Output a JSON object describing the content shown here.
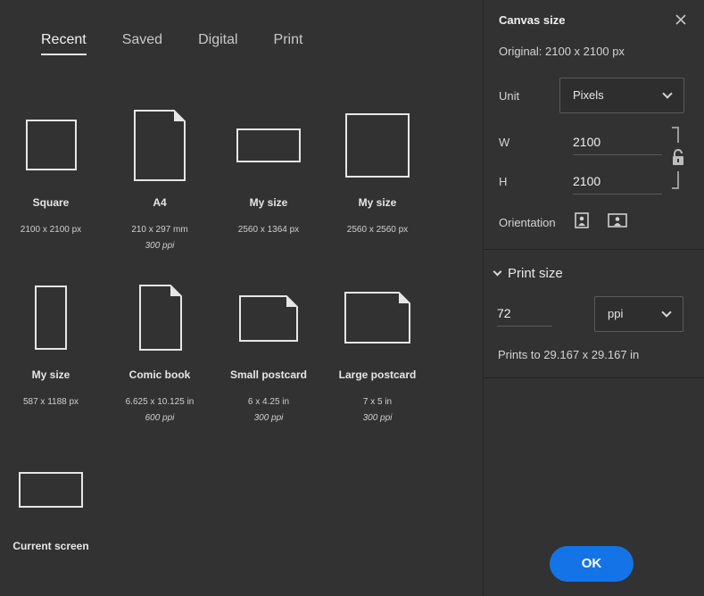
{
  "tabs": [
    {
      "label": "Recent"
    },
    {
      "label": "Saved"
    },
    {
      "label": "Digital"
    },
    {
      "label": "Print"
    }
  ],
  "presets": [
    {
      "name": "Square",
      "dims": "2100 x 2100 px",
      "ppi": ""
    },
    {
      "name": "A4",
      "dims": "210 x 297 mm",
      "ppi": "300 ppi"
    },
    {
      "name": "My size",
      "dims": "2560 x 1364 px",
      "ppi": ""
    },
    {
      "name": "My size",
      "dims": "2560 x 2560 px",
      "ppi": ""
    },
    {
      "name": "My size",
      "dims": "587 x 1188 px",
      "ppi": ""
    },
    {
      "name": "Comic book",
      "dims": "6.625 x 10.125 in",
      "ppi": "600 ppi"
    },
    {
      "name": "Small postcard",
      "dims": "6 x 4.25 in",
      "ppi": "300 ppi"
    },
    {
      "name": "Large postcard",
      "dims": "7 x 5 in",
      "ppi": "300 ppi"
    },
    {
      "name": "Current screen",
      "dims": "",
      "ppi": ""
    }
  ],
  "panel": {
    "title": "Canvas size",
    "close_icon": "close-icon",
    "original": "Original: 2100 x 2100 px",
    "unit_label": "Unit",
    "unit_value": "Pixels",
    "w_label": "W",
    "w_value": "2100",
    "h_label": "H",
    "h_value": "2100",
    "orientation_label": "Orientation",
    "print_size_title": "Print size",
    "resolution_value": "72",
    "resolution_unit": "ppi",
    "prints_to": "Prints to 29.167 x 29.167 in",
    "ok_label": "OK"
  },
  "colors": {
    "background": "#323232",
    "accent": "#1473e6"
  }
}
